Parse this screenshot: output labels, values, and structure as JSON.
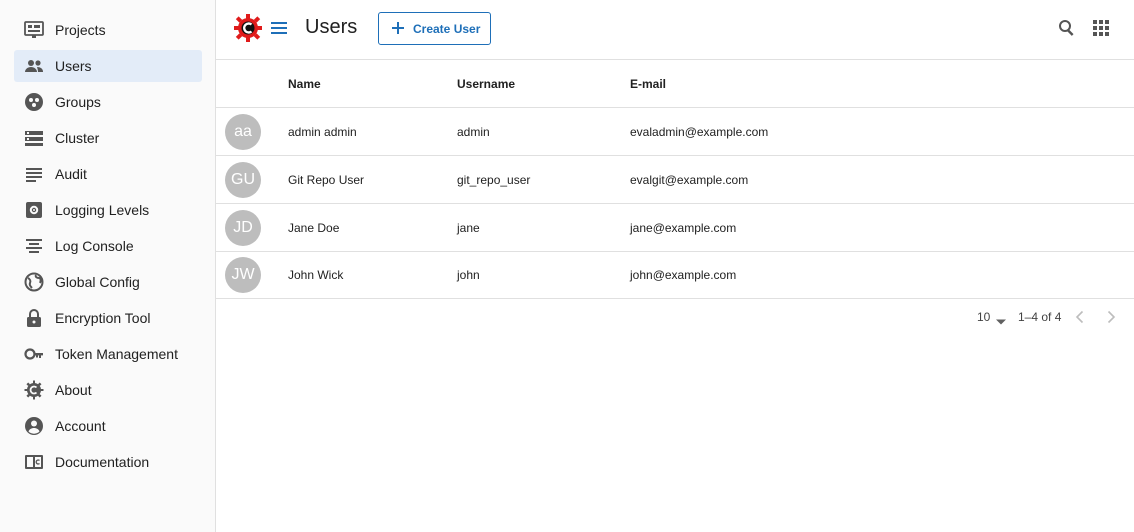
{
  "sidebar": {
    "items": [
      {
        "label": "Projects",
        "icon": "projects-icon",
        "active": false
      },
      {
        "label": "Users",
        "icon": "users-icon",
        "active": true
      },
      {
        "label": "Groups",
        "icon": "groups-icon",
        "active": false
      },
      {
        "label": "Cluster",
        "icon": "cluster-icon",
        "active": false
      },
      {
        "label": "Audit",
        "icon": "audit-icon",
        "active": false
      },
      {
        "label": "Logging Levels",
        "icon": "logging-levels-icon",
        "active": false
      },
      {
        "label": "Log Console",
        "icon": "log-console-icon",
        "active": false
      },
      {
        "label": "Global Config",
        "icon": "globe-icon",
        "active": false
      },
      {
        "label": "Encryption Tool",
        "icon": "lock-icon",
        "active": false
      },
      {
        "label": "Token Management",
        "icon": "key-icon",
        "active": false
      },
      {
        "label": "About",
        "icon": "about-icon",
        "active": false
      },
      {
        "label": "Account",
        "icon": "account-icon",
        "active": false
      },
      {
        "label": "Documentation",
        "icon": "book-icon",
        "active": false
      }
    ]
  },
  "header": {
    "title": "Users",
    "create_label": "Create User"
  },
  "table": {
    "columns": {
      "name": "Name",
      "username": "Username",
      "email": "E-mail"
    },
    "rows": [
      {
        "initials": "aa",
        "name": "admin admin",
        "username": "admin",
        "email": "evaladmin@example.com"
      },
      {
        "initials": "GU",
        "name": "Git Repo User",
        "username": "git_repo_user",
        "email": "evalgit@example.com"
      },
      {
        "initials": "JD",
        "name": "Jane Doe",
        "username": "jane",
        "email": "jane@example.com"
      },
      {
        "initials": "JW",
        "name": "John Wick",
        "username": "john",
        "email": "john@example.com"
      }
    ]
  },
  "pagination": {
    "rows_per_page": "10",
    "range": "1–4 of 4"
  },
  "colors": {
    "accent": "#1e6fb8",
    "active_nav_bg": "#e3ecf8",
    "avatar_bg": "#bdbdbd",
    "logo_red": "#e01b1b"
  }
}
